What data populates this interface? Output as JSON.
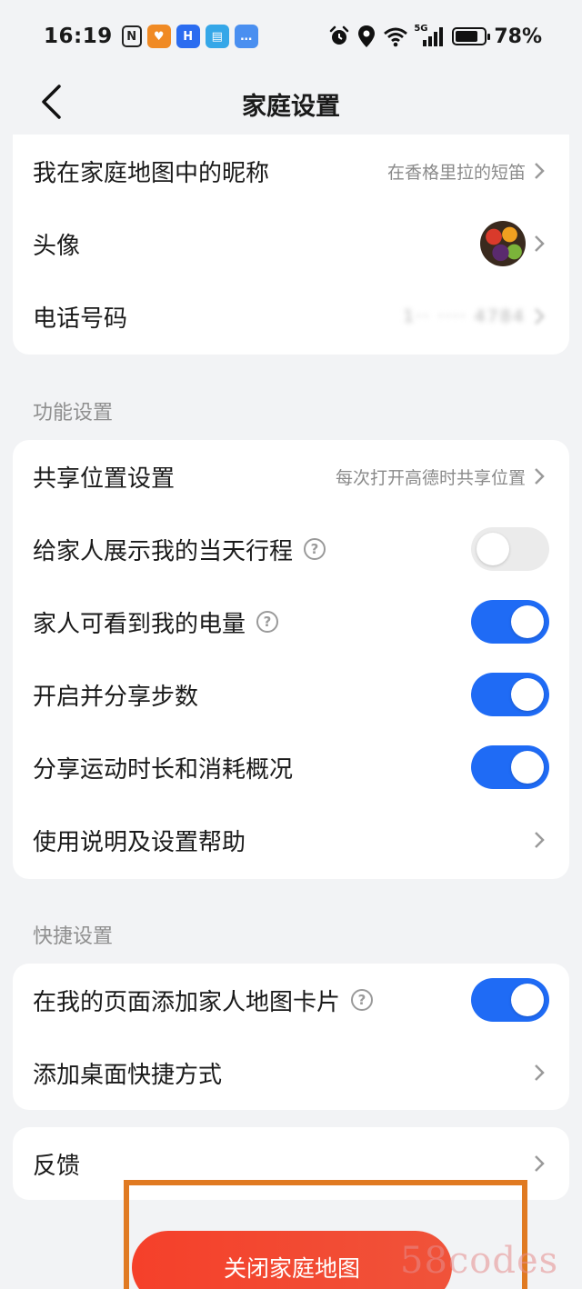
{
  "status_bar": {
    "time": "16:19",
    "nfc_label": "N",
    "apps": [
      {
        "name": "heart-app",
        "glyph": "♥",
        "color": "#f08a24"
      },
      {
        "name": "honor-app",
        "glyph": "H",
        "color": "#2b6cf0"
      },
      {
        "name": "book-app",
        "glyph": "▤",
        "color": "#35a7e8"
      },
      {
        "name": "message-app",
        "glyph": "…",
        "color": "#4a8ff0"
      }
    ],
    "network": "5G",
    "battery": "78%",
    "battery_level": 0.78
  },
  "header": {
    "title": "家庭设置"
  },
  "profile": {
    "nickname_label": "我在家庭地图中的昵称",
    "nickname_value": "在香格里拉的短笛",
    "avatar_label": "头像",
    "phone_label": "电话号码",
    "phone_value": "1·· ···· 4784"
  },
  "features": {
    "section_title": "功能设置",
    "share_location_label": "共享位置设置",
    "share_location_value": "每次打开高德时共享位置",
    "show_itinerary_label": "给家人展示我的当天行程",
    "show_itinerary_on": false,
    "battery_visible_label": "家人可看到我的电量",
    "battery_visible_on": true,
    "share_steps_label": "开启并分享步数",
    "share_steps_on": true,
    "share_sports_label": "分享运动时长和消耗概况",
    "share_sports_on": true,
    "help_label": "使用说明及设置帮助"
  },
  "shortcuts": {
    "section_title": "快捷设置",
    "add_card_label": "在我的页面添加家人地图卡片",
    "add_card_on": true,
    "desktop_shortcut_label": "添加桌面快捷方式"
  },
  "feedback": {
    "label": "反馈"
  },
  "bottom": {
    "close_button": "关闭家庭地图",
    "watermark": "58codes"
  },
  "help_glyph": "?",
  "colors": {
    "accent": "#1f6bf5",
    "danger": "#f5402a",
    "highlight": "#e07a22"
  }
}
